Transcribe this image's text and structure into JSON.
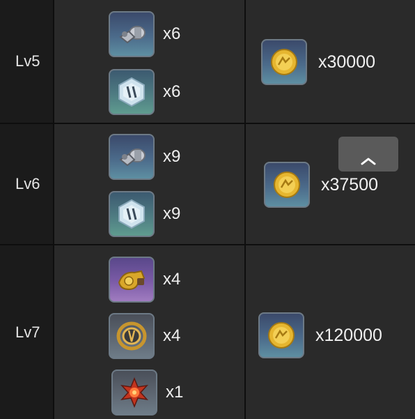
{
  "rows": [
    {
      "level": "Lv5",
      "materials": [
        {
          "icon": "gear-parts-icon",
          "qty": "x6"
        },
        {
          "icon": "crystal-ring-icon",
          "qty": "x6"
        }
      ],
      "coin": {
        "icon": "gold-coin-icon",
        "qty": "x30000"
      }
    },
    {
      "level": "Lv6",
      "materials": [
        {
          "icon": "gear-parts-icon",
          "qty": "x9"
        },
        {
          "icon": "crystal-ring-icon",
          "qty": "x9"
        }
      ],
      "coin": {
        "icon": "gold-coin-icon",
        "qty": "x37500"
      }
    },
    {
      "level": "Lv7",
      "materials": [
        {
          "icon": "golden-engine-icon",
          "qty": "x4"
        },
        {
          "icon": "golden-ring-icon",
          "qty": "x4"
        },
        {
          "icon": "red-core-icon",
          "qty": "x1"
        }
      ],
      "coin": {
        "icon": "gold-coin-icon",
        "qty": "x120000"
      }
    }
  ],
  "collapse_button": {
    "icon": "chevron-up-icon"
  }
}
